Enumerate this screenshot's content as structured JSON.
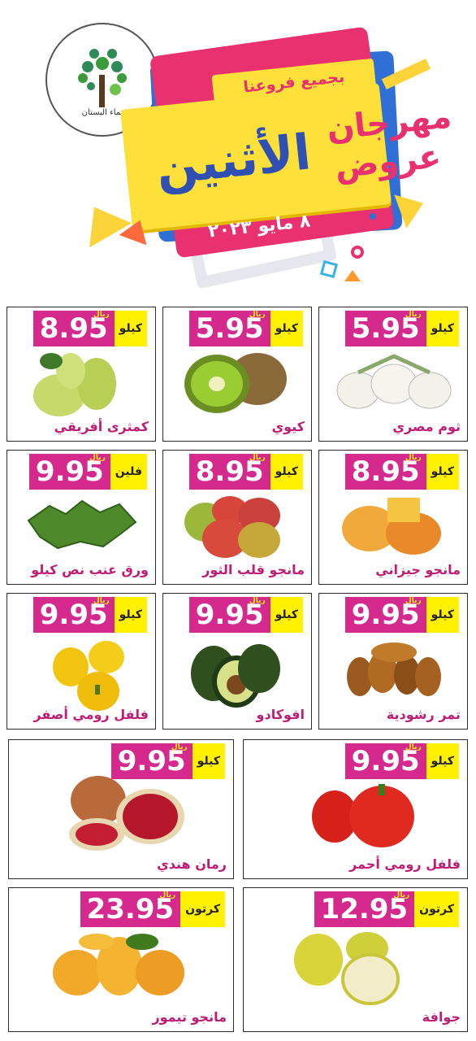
{
  "header": {
    "logo_text": "نماء البستان",
    "branches": "بجميع فروعنا",
    "line1": "مهرجان",
    "line2": "عروض",
    "line3": "الأثنين",
    "date": "٨ مايو ٢٠٢٣"
  },
  "currency": "ريال",
  "products": [
    {
      "name": "ثوم مصري",
      "unit": "كيلو",
      "price": "5.95"
    },
    {
      "name": "كيوي",
      "unit": "كيلو",
      "price": "5.95"
    },
    {
      "name": "كمثرى أفريقي",
      "unit": "كيلو",
      "price": "8.95"
    },
    {
      "name": "مانجو جيزاني",
      "unit": "كيلو",
      "price": "8.95"
    },
    {
      "name": "مانجو قلب الثور",
      "unit": "كيلو",
      "price": "8.95"
    },
    {
      "name": "ورق عنب نص كيلو",
      "unit": "فلين",
      "price": "9.95"
    },
    {
      "name": "تمر رشودية",
      "unit": "كيلو",
      "price": "9.95"
    },
    {
      "name": "افوكادو",
      "unit": "كيلو",
      "price": "9.95"
    },
    {
      "name": "فلفل رومي أصفر",
      "unit": "كيلو",
      "price": "9.95"
    },
    {
      "name": "فلفل رومي أحمر",
      "unit": "كيلو",
      "price": "9.95"
    },
    {
      "name": "رمان هندي",
      "unit": "كيلو",
      "price": "9.95"
    },
    {
      "name": "جوافة",
      "unit": "كرتون",
      "price": "12.95"
    },
    {
      "name": "مانجو تيمور",
      "unit": "كرتون",
      "price": "23.95"
    }
  ],
  "colors": {
    "magenta": "#d6298e",
    "yellow": "#fff100",
    "name": "#c01c73"
  }
}
